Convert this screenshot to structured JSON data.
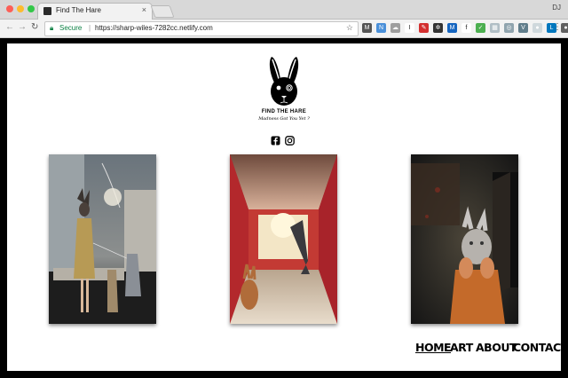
{
  "browser": {
    "tab_title": "Find The Hare",
    "tab_close": "×",
    "user_initials": "DJ",
    "security_label": "Secure",
    "url": "https://sharp-wiles-7282cc.netlify.com",
    "icons": [
      "back-arrow-icon",
      "forward-arrow-icon",
      "reload-icon",
      "lock-icon",
      "bookmark-star-icon",
      "chrome-menu-icon"
    ],
    "extensions": [
      {
        "name": "ext-m-icon",
        "color": "#555555",
        "glyph": "M"
      },
      {
        "name": "ext-new-icon",
        "color": "#4a90d9",
        "glyph": "N"
      },
      {
        "name": "ext-cloud-icon",
        "color": "#9e9e9e",
        "glyph": "☁"
      },
      {
        "name": "ext-i-icon",
        "color": "#ffffff",
        "glyph": "I"
      },
      {
        "name": "ext-pen-icon",
        "color": "#d32f2f",
        "glyph": "✎"
      },
      {
        "name": "ext-react-icon",
        "color": "#333333",
        "glyph": "✲"
      },
      {
        "name": "ext-m2-icon",
        "color": "#1565c0",
        "glyph": "M"
      },
      {
        "name": "ext-fx-icon",
        "color": "#ffffff",
        "glyph": "f"
      },
      {
        "name": "ext-check-icon",
        "color": "#4caf50",
        "glyph": "✓"
      },
      {
        "name": "ext-grid-icon",
        "color": "#b0bec5",
        "glyph": "▦"
      },
      {
        "name": "ext-target-icon",
        "color": "#90a4ae",
        "glyph": "◎"
      },
      {
        "name": "ext-v-icon",
        "color": "#607d8b",
        "glyph": "V"
      },
      {
        "name": "ext-person-icon",
        "color": "#cfd8dc",
        "glyph": "●"
      },
      {
        "name": "ext-l-icon",
        "color": "#0277bd",
        "glyph": "L"
      },
      {
        "name": "ext-clock-icon",
        "color": "#616161",
        "glyph": "●"
      },
      {
        "name": "ext-pocket-icon",
        "color": "#9e9e9e",
        "glyph": "◆"
      }
    ]
  },
  "site": {
    "brand": "FIND THE HARE",
    "tagline": "Madness Got You Yet ?",
    "social": [
      "facebook-icon",
      "instagram-icon"
    ],
    "artworks": [
      {
        "name": "artwork-hare-woman-in-gold-dress"
      },
      {
        "name": "artwork-hare-in-red-room"
      },
      {
        "name": "artwork-hare-masked-figure-in-dark"
      }
    ],
    "nav": {
      "home": "HOME",
      "art": "ART",
      "about": "ABOUT",
      "contact": "CONTACT"
    }
  }
}
